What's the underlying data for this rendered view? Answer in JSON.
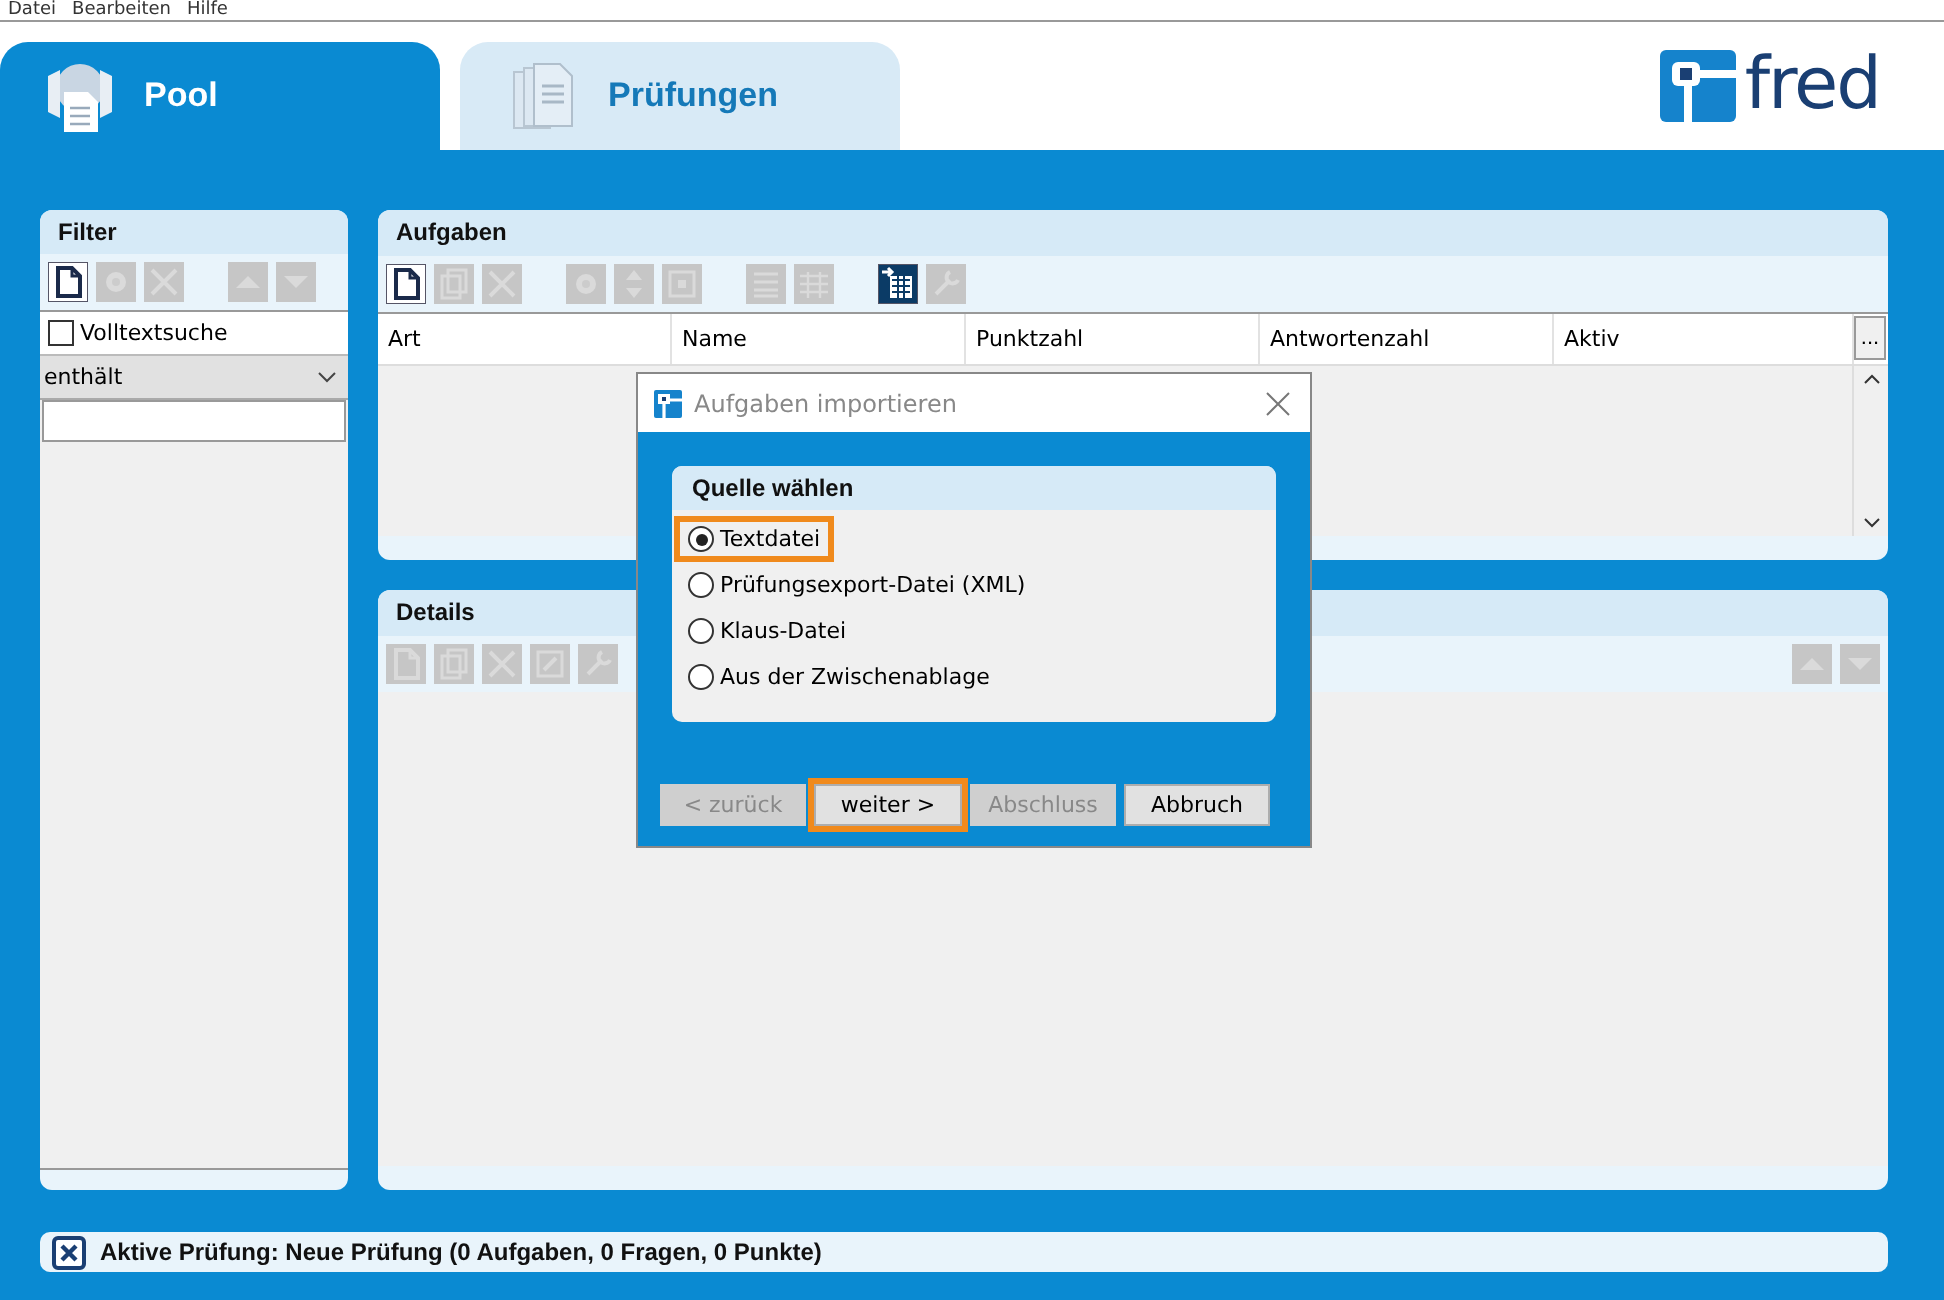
{
  "menu": [
    "Datei",
    "Bearbeiten",
    "Hilfe"
  ],
  "tabs": [
    {
      "label": "Pool",
      "selected": true,
      "kind": "pool"
    },
    {
      "label": "Prüfungen",
      "selected": false,
      "kind": "exams"
    }
  ],
  "logo": {
    "text": "fred"
  },
  "filter": {
    "title": "Filter",
    "toolbar": [
      {
        "kind": "new",
        "disabled": false
      },
      {
        "kind": "gear",
        "disabled": true
      },
      {
        "kind": "delete",
        "disabled": true
      },
      {
        "kind": "gap"
      },
      {
        "kind": "up",
        "disabled": true
      },
      {
        "kind": "down",
        "disabled": true
      }
    ],
    "fulltext": {
      "label": "Volltextsuche",
      "checked": false
    },
    "mode": {
      "value": "enthält"
    }
  },
  "tasks": {
    "title": "Aufgaben",
    "toolbar": [
      {
        "kind": "new",
        "disabled": false
      },
      {
        "kind": "copy",
        "disabled": true
      },
      {
        "kind": "delete",
        "disabled": true
      },
      {
        "kind": "gap"
      },
      {
        "kind": "gear",
        "disabled": true
      },
      {
        "kind": "updown",
        "disabled": true
      },
      {
        "kind": "box",
        "disabled": true
      },
      {
        "kind": "gap"
      },
      {
        "kind": "list",
        "disabled": true
      },
      {
        "kind": "grid",
        "disabled": true
      },
      {
        "kind": "gap"
      },
      {
        "kind": "import",
        "disabled": false
      },
      {
        "kind": "tool",
        "disabled": true
      }
    ],
    "columns": [
      "Art",
      "Name",
      "Punktzahl",
      "Antwortenzahl",
      "Aktiv"
    ],
    "more": "..."
  },
  "details": {
    "title": "Details",
    "toolbar": [
      {
        "kind": "new",
        "disabled": true
      },
      {
        "kind": "copy",
        "disabled": true
      },
      {
        "kind": "delete",
        "disabled": true
      },
      {
        "kind": "edit",
        "disabled": true
      },
      {
        "kind": "tool",
        "disabled": true
      }
    ],
    "toolbar_right": [
      {
        "kind": "up",
        "disabled": true
      },
      {
        "kind": "down",
        "disabled": true
      }
    ]
  },
  "dialog": {
    "title": "Aufgaben importieren",
    "group": "Quelle wählen",
    "options": [
      {
        "label": "Textdatei",
        "selected": true,
        "highlighted": true
      },
      {
        "label": "Prüfungsexport-Datei (XML)",
        "selected": false,
        "highlighted": false
      },
      {
        "label": "Klaus-Datei",
        "selected": false,
        "highlighted": false
      },
      {
        "label": "Aus der Zwischenablage",
        "selected": false,
        "highlighted": false
      }
    ],
    "buttons": [
      {
        "label": "< zurück",
        "disabled": true,
        "highlighted": false
      },
      {
        "label": "weiter >",
        "disabled": false,
        "highlighted": true
      },
      {
        "label": "Abschluss",
        "disabled": true,
        "highlighted": false
      },
      {
        "label": "Abbruch",
        "disabled": false,
        "highlighted": false
      }
    ]
  },
  "status": {
    "text": "Aktive Prüfung: Neue Prüfung (0 Aufgaben, 0 Fragen, 0 Punkte)"
  }
}
